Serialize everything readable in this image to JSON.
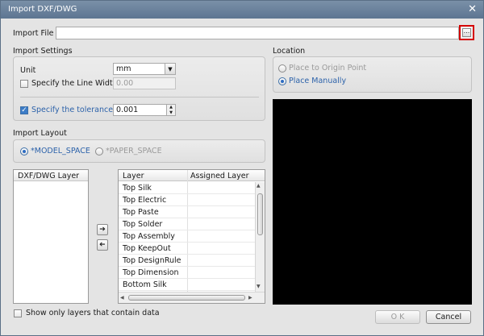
{
  "window": {
    "title": "Import DXF/DWG"
  },
  "import_file": {
    "label": "Import File",
    "value": "",
    "browse_label": "..."
  },
  "import_settings": {
    "title": "Import Settings",
    "unit_label": "Unit",
    "unit_value": "mm",
    "line_width_label": "Specify the Line Width",
    "line_width_value": "0.00",
    "line_width_checked": false,
    "tolerance_label": "Specify the tolerance",
    "tolerance_value": "0.001",
    "tolerance_checked": true
  },
  "location": {
    "title": "Location",
    "options": [
      {
        "label": "Place to Origin Point",
        "selected": false
      },
      {
        "label": "Place Manually",
        "selected": true
      }
    ]
  },
  "import_layout": {
    "title": "Import Layout",
    "options": [
      {
        "label": "*MODEL_SPACE",
        "selected": true
      },
      {
        "label": "*PAPER_SPACE",
        "selected": false
      }
    ]
  },
  "dxf_layers": {
    "header": "DXF/DWG Layer",
    "items": []
  },
  "layer_map": {
    "header_layer": "Layer",
    "header_assigned": "Assigned Layer",
    "rows": [
      {
        "layer": "Top Silk",
        "assigned": ""
      },
      {
        "layer": "Top Electric",
        "assigned": ""
      },
      {
        "layer": "Top Paste",
        "assigned": ""
      },
      {
        "layer": "Top Solder",
        "assigned": ""
      },
      {
        "layer": "Top Assembly",
        "assigned": ""
      },
      {
        "layer": "Top KeepOut",
        "assigned": ""
      },
      {
        "layer": "Top DesignRule",
        "assigned": ""
      },
      {
        "layer": "Top Dimension",
        "assigned": ""
      },
      {
        "layer": "Bottom Silk",
        "assigned": ""
      }
    ]
  },
  "show_only_layers": {
    "label": "Show only layers that contain data",
    "checked": false
  },
  "footer": {
    "ok_label": "O K",
    "cancel_label": "Cancel"
  },
  "colors": {
    "accent": "#2c62aa",
    "highlight": "#d40000",
    "preview_bg": "#000000"
  }
}
